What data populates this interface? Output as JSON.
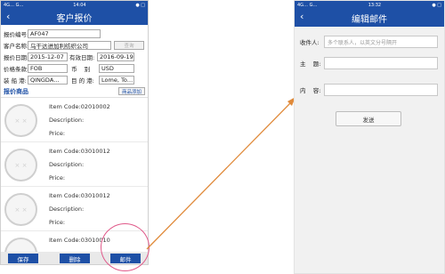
{
  "left": {
    "status": {
      "left": "4G… G…",
      "time": "14:04",
      "right": "● □"
    },
    "title": "客户报价",
    "back": "‹",
    "form": {
      "quote_no_label": "报价编号:",
      "quote_no": "AF047",
      "customer_label": "客户名称:",
      "customer": "乌干达进加利纺织公司",
      "query_btn": "查询",
      "quote_date_label": "报价日期:",
      "quote_date": "2015-12-07",
      "valid_date_label": "有效日期:",
      "valid_date": "2016-09-19",
      "price_terms_label": "价格条款:",
      "price_terms": "FOB",
      "currency_label": "币    别",
      "currency": "USD",
      "load_port_label": "装 船 港:",
      "load_port": "QINGDA…",
      "dest_port_label": "目 的 港:",
      "dest_port": "Lome, To…"
    },
    "section_title": "报价商品",
    "add_goods": "商品添加",
    "goods": [
      {
        "code": "Item Code:02010002",
        "desc": "Description:",
        "price": "Price:"
      },
      {
        "code": "Item Code:03010012",
        "desc": "Description:",
        "price": "Price:"
      },
      {
        "code": "Item Code:03010012",
        "desc": "Description:",
        "price": "Price:"
      },
      {
        "code": "Item Code:03010010"
      }
    ],
    "buttons": {
      "save": "保存",
      "delete": "删除",
      "mail": "邮件"
    }
  },
  "right": {
    "status": {
      "left": "4G… G…",
      "time": "13:32",
      "right": "● □"
    },
    "title": "编辑邮件",
    "back": "‹",
    "recipient_label": "收件人:",
    "recipient_placeholder": "多个联系人，以英文分号隔开",
    "subject_label": "主    题:",
    "content_label": "内    容:",
    "send": "发送"
  },
  "colors": {
    "brand": "#1e50a6",
    "annotation": "#e05a8a",
    "arrow": "#e08a3a"
  }
}
